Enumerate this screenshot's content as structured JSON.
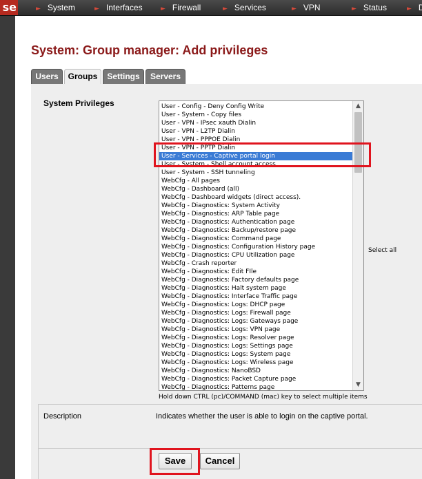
{
  "nav": {
    "logo": "se",
    "items": [
      {
        "label": "System"
      },
      {
        "label": "Interfaces"
      },
      {
        "label": "Firewall"
      },
      {
        "label": "Services"
      },
      {
        "label": "VPN"
      },
      {
        "label": "Status"
      },
      {
        "label": "D"
      }
    ]
  },
  "page_title": "System: Group manager: Add privileges",
  "tabs": [
    {
      "label": "Users",
      "active": false
    },
    {
      "label": "Groups",
      "active": true
    },
    {
      "label": "Settings",
      "active": false
    },
    {
      "label": "Servers",
      "active": false
    }
  ],
  "privileges": {
    "label": "System Privileges",
    "options": [
      "User - Config - Deny Config Write",
      "User - System - Copy files",
      "User - VPN - IPsec xauth Dialin",
      "User - VPN - L2TP Dialin",
      "User - VPN - PPPOE Dialin",
      "User - VPN - PPTP Dialin",
      "User - Services - Captive portal login",
      "User - System - Shell account access",
      "User - System - SSH tunneling",
      "WebCfg - All pages",
      "WebCfg - Dashboard (all)",
      "WebCfg - Dashboard widgets (direct access).",
      "WebCfg - Diagnostics: System Activity",
      "WebCfg - Diagnostics: ARP Table page",
      "WebCfg - Diagnostics: Authentication page",
      "WebCfg - Diagnostics: Backup/restore page",
      "WebCfg - Diagnostics: Command page",
      "WebCfg - Diagnostics: Configuration History page",
      "WebCfg - Diagnostics: CPU Utilization page",
      "WebCfg - Crash reporter",
      "WebCfg - Diagnostics: Edit FIle",
      "WebCfg - Diagnostics: Factory defaults page",
      "WebCfg - Diagnostics: Halt system page",
      "WebCfg - Diagnostics: Interface Traffic page",
      "WebCfg - Diagnostics: Logs: DHCP page",
      "WebCfg - Diagnostics: Logs: Firewall page",
      "WebCfg - Diagnostics: Logs: Gateways page",
      "WebCfg - Diagnostics: Logs: VPN page",
      "WebCfg - Diagnostics: Logs: Resolver page",
      "WebCfg - Diagnostics: Logs: Settings page",
      "WebCfg - Diagnostics: Logs: System page",
      "WebCfg - Diagnostics: Logs: Wireless page",
      "WebCfg - Diagnostics: NanoBSD",
      "WebCfg - Diagnostics: Packet Capture page",
      "WebCfg - Diagnostics: Patterns page"
    ],
    "selected_index": 6,
    "hint": "Hold down CTRL (pc)/COMMAND (mac) key to select multiple items",
    "select_all_label": "Select all"
  },
  "description": {
    "label": "Description",
    "text": "Indicates whether the user is able to login on the captive portal."
  },
  "buttons": {
    "save_label": "Save",
    "cancel_label": "Cancel"
  },
  "colors": {
    "title": "#8b1a1a",
    "selection": "#3a7bd5",
    "annotation_box": "#e0141e",
    "nav_arrow": "#d94a3a"
  }
}
